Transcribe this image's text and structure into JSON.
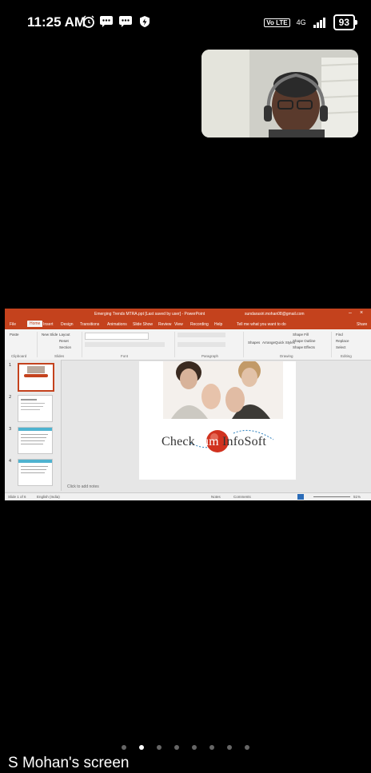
{
  "status_bar": {
    "time": "11:25 AM",
    "volte": "Vo LTE",
    "network": "4G",
    "battery": "93",
    "icons": [
      "alarm-icon",
      "message-icon",
      "message-icon",
      "shield-icon",
      "signal-icon"
    ]
  },
  "video_call": {
    "participant": "S Mohan"
  },
  "shared_screen": {
    "app_title": "Emerging Trends MTRA.ppt [Last saved by user] - PowerPoint",
    "account": "sundarasiri.mohan08@gmail.com",
    "menu_tabs": [
      "File",
      "Home",
      "Insert",
      "Design",
      "Transitions",
      "Animations",
      "Slide Show",
      "Review",
      "View",
      "Recording",
      "Help",
      "Tell me what you want to do",
      "Share"
    ],
    "ribbon": {
      "groups": [
        "Clipboard",
        "Slides",
        "Font",
        "Paragraph",
        "Drawing",
        "Editing"
      ],
      "buttons": [
        "Paste",
        "New Slide",
        "Layout",
        "Reset",
        "Section",
        "Shapes",
        "Arrange",
        "Quick Styles",
        "Shape Fill",
        "Shape Outline",
        "Shape Effects",
        "Find",
        "Replace",
        "Select"
      ]
    },
    "slide_numbers": [
      "1",
      "2",
      "3",
      "4"
    ],
    "slide": {
      "brand_left": "Check",
      "brand_mid": "Sum",
      "brand_right": "InfoSoft"
    },
    "notes_placeholder": "Click to add notes",
    "status": {
      "slide_info": "Slide 1 of 6",
      "language": "English (India)",
      "notes": "Notes",
      "comments": "Comments",
      "zoom": "51%"
    }
  },
  "pager": {
    "count": 8,
    "active": 1
  },
  "caption": "S Mohan's screen"
}
